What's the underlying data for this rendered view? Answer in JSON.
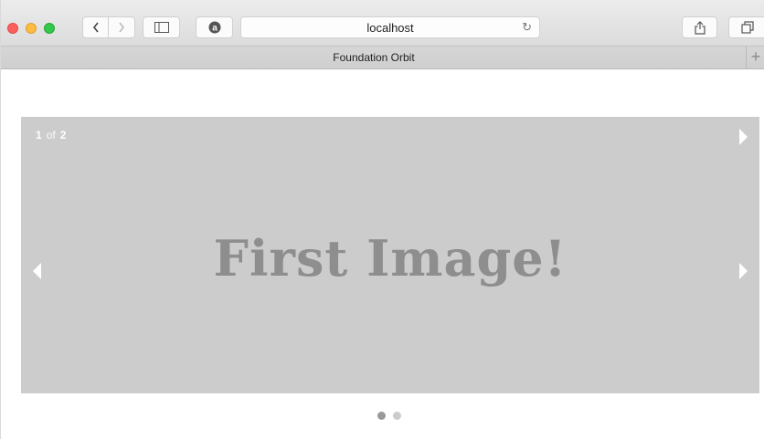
{
  "browser": {
    "address": "localhost",
    "tab_title": "Foundation Orbit",
    "tab_add": "+",
    "reload_icon": "↻"
  },
  "slider": {
    "current": "1",
    "of_label": "of",
    "total": "2",
    "slide_text": "First Image!",
    "background": "#cccccc",
    "bullets": [
      {
        "active": true
      },
      {
        "active": false
      }
    ]
  }
}
